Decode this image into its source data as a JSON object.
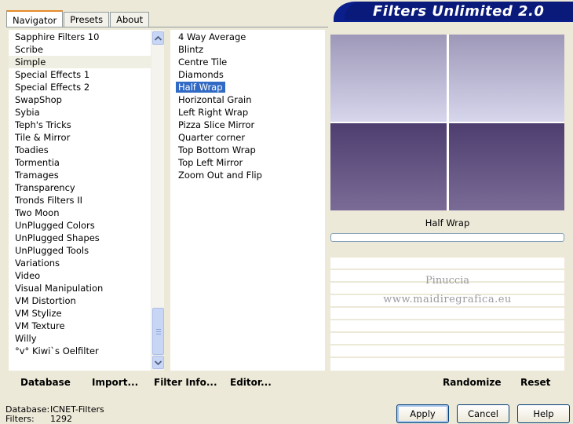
{
  "tabs": [
    {
      "label": "Navigator",
      "active": true
    },
    {
      "label": "Presets",
      "active": false
    },
    {
      "label": "About",
      "active": false
    }
  ],
  "app_title": "Filters Unlimited 2.0",
  "categories": {
    "items": [
      "Sapphire Filters 10",
      "Scribe",
      "Simple",
      "Special Effects 1",
      "Special Effects 2",
      "SwapShop",
      "Sybia",
      "Teph's Tricks",
      "Tile & Mirror",
      "Toadies",
      "Tormentia",
      "Tramages",
      "Transparency",
      "Tronds Filters II",
      "Two Moon",
      "UnPlugged Colors",
      "UnPlugged Shapes",
      "UnPlugged Tools",
      "Variations",
      "Video",
      "Visual Manipulation",
      "VM Distortion",
      "VM Stylize",
      "VM Texture",
      "Willy",
      "°v° Kiwi`s Oelfilter"
    ],
    "selected": "Simple"
  },
  "filters": {
    "items": [
      "4 Way Average",
      "Blintz",
      "Centre Tile",
      "Diamonds",
      "Half Wrap",
      "Horizontal Grain",
      "Left Right Wrap",
      "Pizza Slice Mirror",
      "Quarter corner",
      "Top Bottom Wrap",
      "Top Left Mirror",
      "Zoom Out and Flip"
    ],
    "selected": "Half Wrap"
  },
  "preview": {
    "filter_name": "Half Wrap",
    "progress": 0,
    "watermark_line1": "Pinuccia",
    "watermark_line2": "www.maidiregrafica.eu"
  },
  "left_actions": {
    "database": "Database",
    "import": "Import...",
    "filter_info": "Filter Info...",
    "editor": "Editor..."
  },
  "right_actions": {
    "randomize": "Randomize",
    "reset": "Reset"
  },
  "status": {
    "database_label": "Database:",
    "database_value": "ICNET-Filters",
    "filters_label": "Filters:",
    "filters_value": "1292"
  },
  "buttons": {
    "apply": "Apply",
    "cancel": "Cancel",
    "help": "Help"
  },
  "colors": {
    "selection": "#316ac5",
    "banner": "#0a1a7a",
    "tab_accent": "#e68b2c"
  }
}
